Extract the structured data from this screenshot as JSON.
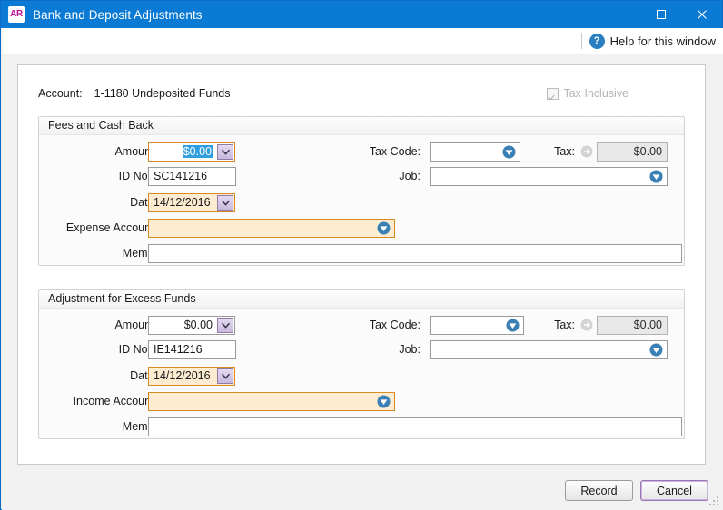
{
  "window": {
    "app_badge": "AR",
    "title": "Bank and Deposit Adjustments",
    "minimize_label": "Minimize",
    "maximize_label": "Maximize",
    "close_label": "Close"
  },
  "helpbar": {
    "icon": "question-mark-icon",
    "label": "Help for this window"
  },
  "account": {
    "label": "Account:",
    "value": "1-1180 Undeposited Funds"
  },
  "tax_inclusive": {
    "label": "Tax Inclusive",
    "checked": true,
    "enabled": false
  },
  "sections": [
    {
      "title": "Fees and Cash Back",
      "amount_label": "Amount:",
      "amount_value": "$0.00",
      "amount_selected": true,
      "id_label": "ID No. :",
      "id_value": "SC141216",
      "date_label": "Date:",
      "date_value": "14/12/2016",
      "account_label": "Expense Account:",
      "account_value": "",
      "memo_label": "Memo:",
      "memo_value": "",
      "tax_code_label": "Tax Code:",
      "tax_code_value": "",
      "tax_label": "Tax:",
      "tax_value": "$0.00",
      "job_label": "Job:",
      "job_value": ""
    },
    {
      "title": "Adjustment for Excess Funds",
      "amount_label": "Amount:",
      "amount_value": "$0.00",
      "amount_selected": false,
      "id_label": "ID No. :",
      "id_value": "IE141216",
      "date_label": "Date:",
      "date_value": "14/12/2016",
      "account_label": "Income Account:",
      "account_value": "",
      "memo_label": "Memo:",
      "memo_value": "",
      "tax_code_label": "Tax Code:",
      "tax_code_value": "",
      "tax_label": "Tax:",
      "tax_value": "$0.00",
      "job_label": "Job:",
      "job_value": ""
    }
  ],
  "footer": {
    "record_label": "Record",
    "cancel_label": "Cancel"
  },
  "colors": {
    "titlebar": "#0b7ad4",
    "badge_text": "#c2109b",
    "highlight_field_border": "#d98b23",
    "highlight_field_bg": "#fdecd2",
    "selection_blue": "#2f9fe0",
    "dropdown_blue": "#2f7fb4",
    "default_button_border": "#9a74b5"
  }
}
